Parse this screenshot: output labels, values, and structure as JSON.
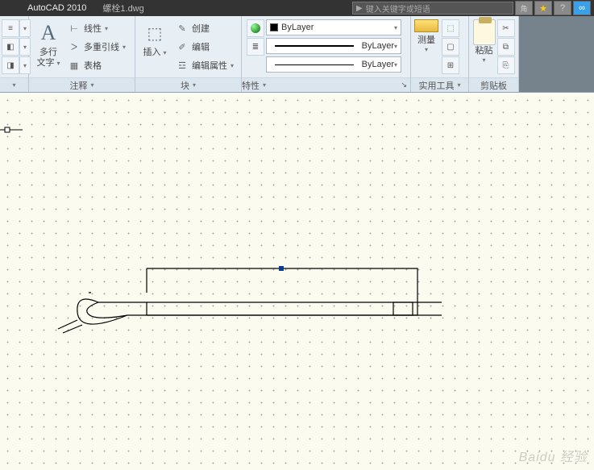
{
  "title": {
    "app": "AutoCAD 2010",
    "doc": "螺栓1.dwg"
  },
  "search": {
    "placeholder": "键入关键字或短语"
  },
  "ribbon": {
    "annotate": {
      "panel": "注释",
      "mtext_top": "多行",
      "mtext_bot": "文字",
      "linear": "线性",
      "mleader": "多重引线",
      "table": "表格"
    },
    "block": {
      "panel": "块",
      "insert": "插入",
      "create": "创建",
      "edit": "编辑",
      "editattr": "编辑属性"
    },
    "properties": {
      "panel": "特性",
      "bylayer": "ByLayer",
      "bylayer2": "ByLayer",
      "bylayer3": "ByLayer"
    },
    "utilities": {
      "panel": "实用工具",
      "measure": "测量"
    },
    "clipboard": {
      "panel": "剪贴板",
      "paste": "粘贴"
    }
  },
  "watermark": "Baidu 经验"
}
